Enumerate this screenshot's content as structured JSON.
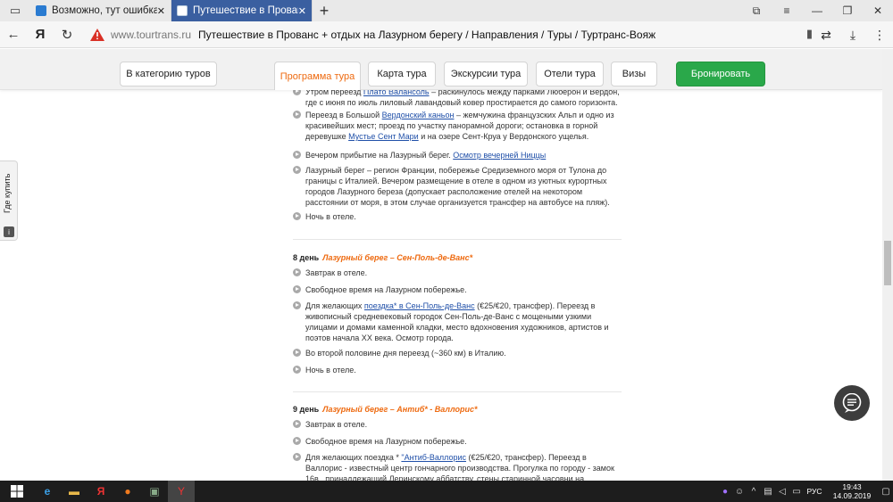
{
  "browser": {
    "tabs": [
      {
        "title": "Возможно, тут ошибка? - С",
        "active": false
      },
      {
        "title": "Путешествие в Прованс",
        "active": true
      }
    ],
    "url_host": "www.tourtrans.ru",
    "page_title": "Путешествие в Прованс + отдых на Лазурном берегу / Направления / Туры / Туртранс-Вояж",
    "ya_label": "Я"
  },
  "menu": {
    "category": "В категорию туров",
    "program": "Программа тура",
    "map": "Карта тура",
    "excursions": "Экскурсии тура",
    "hotels": "Отели тура",
    "visas": "Визы",
    "book": "Бронировать"
  },
  "side_tab": {
    "label": "Где купить"
  },
  "program": {
    "day7": [
      {
        "parts": [
          {
            "t": "Утром переезд "
          },
          {
            "t": "Плато Валансоль",
            "link": true
          },
          {
            "t": " – раскинулось между парками Люберон и Вердон, где с июня по июль лиловый лавандовый ковер простирается до самого горизонта."
          }
        ]
      },
      {
        "parts": [
          {
            "t": "Переезд в Большой "
          },
          {
            "t": "Вердонский каньон",
            "link": true
          },
          {
            "t": " – жемчужина французских Альп и одно из красивейших мест; проезд по участку панорамной дороги; остановка в горной деревушке "
          },
          {
            "t": "Мустье Сент Мари",
            "link": true
          },
          {
            "t": " и на озере Сент-Круа у Вердонского ущелья."
          }
        ]
      },
      {
        "parts": [
          {
            "t": "Вечером прибытие на Лазурный берег. "
          },
          {
            "t": "Осмотр вечерней Ниццы",
            "link": true
          }
        ]
      },
      {
        "parts": [
          {
            "t": "Лазурный берег – регион Франции, побережье Средиземного моря от Тулона до границы с Италией. Вечером размещение в отеле в одном из уютных курортных городов Лазурного береза (допускает расположение отелей на некотором расстоянии от моря, в этом случае организуется трансфер на автобусе на пляж)."
          }
        ]
      },
      {
        "parts": [
          {
            "t": "Ночь в отеле."
          }
        ]
      }
    ],
    "day8": {
      "label": "8 день",
      "route": "Лазурный берег – Сен-Поль-де-Ванс*",
      "items": [
        {
          "parts": [
            {
              "t": "Завтрак в отеле."
            }
          ]
        },
        {
          "parts": [
            {
              "t": "Свободное время на Лазурном побережье."
            }
          ]
        },
        {
          "parts": [
            {
              "t": "Для желающих "
            },
            {
              "t": "поездка* в Сен-Поль-де-Ванс",
              "link": true
            },
            {
              "t": " (€25/€20, трансфер). Переезд в живописный средневековый городок Сен-Поль-де-Ванс с мощеными узкими улицами и домами каменной кладки, место вдохновения художников, артистов и поэтов начала XX века. Осмотр города."
            }
          ]
        },
        {
          "parts": [
            {
              "t": "Во второй половине дня переезд (~360 км) в Италию."
            }
          ]
        },
        {
          "parts": [
            {
              "t": "Ночь в отеле."
            }
          ]
        }
      ]
    },
    "day9": {
      "label": "9 день",
      "route": "Лазурный берег – Антиб* - Валлорис*",
      "items": [
        {
          "parts": [
            {
              "t": "Завтрак в отеле."
            }
          ]
        },
        {
          "parts": [
            {
              "t": "Свободное время на Лазурном побережье."
            }
          ]
        },
        {
          "parts": [
            {
              "t": "Для желающих поездка * "
            },
            {
              "t": "\"Антиб-Валлорис",
              "link": true
            },
            {
              "t": " (€25/€20, трансфер). Переезд в Валлорис - известный центр гончарного производства. Прогулка по городу -  замок 16в., принадлежащий Леринскому аббатству, стены старинной часовни на территории"
            }
          ]
        }
      ]
    }
  },
  "taskbar": {
    "lang": "РУС",
    "time": "19:43",
    "date": "14.09.2019"
  }
}
